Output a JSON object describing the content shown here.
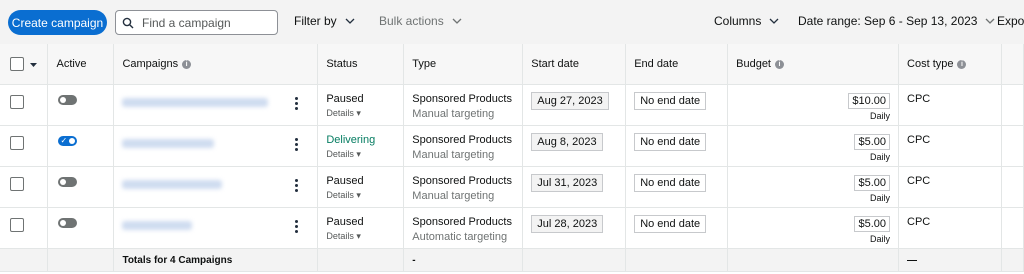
{
  "toolbar": {
    "create_label": "Create campaign",
    "search_placeholder": "Find a campaign",
    "filter_label": "Filter by",
    "bulk_label": "Bulk actions",
    "columns_label": "Columns",
    "date_range_label": "Date range: Sep 6 - Sep 13, 2023",
    "export_label": "Expor"
  },
  "table": {
    "headers": {
      "active": "Active",
      "campaigns": "Campaigns",
      "status": "Status",
      "type": "Type",
      "start_date": "Start date",
      "end_date": "End date",
      "budget": "Budget",
      "cost_type": "Cost type"
    },
    "rows": [
      {
        "active": false,
        "status": "Paused",
        "details": "Details",
        "type": "Sponsored Products",
        "targeting": "Manual targeting",
        "start_date": "Aug 27, 2023",
        "end_date": "No end date",
        "budget": "$10.00",
        "budget_period": "Daily",
        "cost_type": "CPC"
      },
      {
        "active": true,
        "status": "Delivering",
        "details": "Details",
        "type": "Sponsored Products",
        "targeting": "Manual targeting",
        "start_date": "Aug 8, 2023",
        "end_date": "No end date",
        "budget": "$5.00",
        "budget_period": "Daily",
        "cost_type": "CPC"
      },
      {
        "active": false,
        "status": "Paused",
        "details": "Details",
        "type": "Sponsored Products",
        "targeting": "Manual targeting",
        "start_date": "Jul 31, 2023",
        "end_date": "No end date",
        "budget": "$5.00",
        "budget_period": "Daily",
        "cost_type": "CPC"
      },
      {
        "active": false,
        "status": "Paused",
        "details": "Details",
        "type": "Sponsored Products",
        "targeting": "Automatic targeting",
        "start_date": "Jul 28, 2023",
        "end_date": "No end date",
        "budget": "$5.00",
        "budget_period": "Daily",
        "cost_type": "CPC"
      }
    ],
    "totals": {
      "label": "Totals for 4 Campaigns",
      "type": "-",
      "cost_type": "—"
    }
  },
  "colors": {
    "primary": "#0a6ed1",
    "delivering": "#067d62",
    "toggle_off": "#6f7373"
  }
}
